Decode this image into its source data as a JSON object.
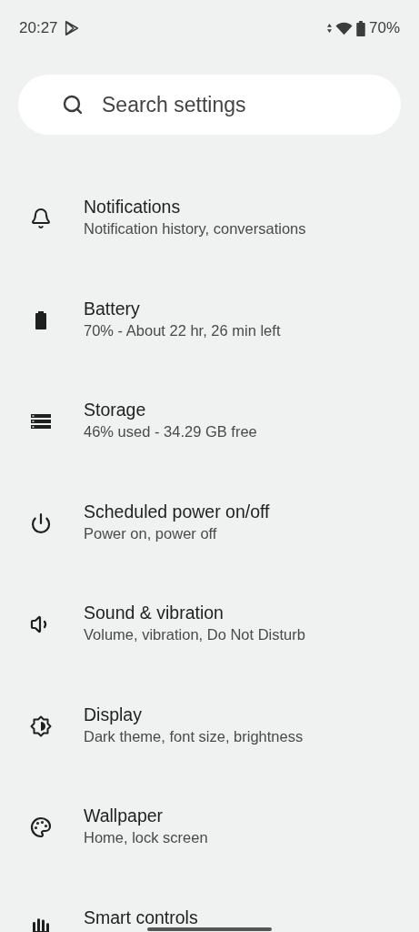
{
  "status_bar": {
    "time": "20:27",
    "battery": "70%"
  },
  "search": {
    "placeholder": "Search settings"
  },
  "settings": [
    {
      "kind": "notifications",
      "title": "Notifications",
      "subtitle": "Notification history, conversations"
    },
    {
      "kind": "battery",
      "title": "Battery",
      "subtitle": "70% - About 22 hr, 26 min left"
    },
    {
      "kind": "storage",
      "title": "Storage",
      "subtitle": "46% used - 34.29 GB free"
    },
    {
      "kind": "power",
      "title": "Scheduled power on/off",
      "subtitle": "Power on, power off"
    },
    {
      "kind": "sound",
      "title": "Sound & vibration",
      "subtitle": "Volume, vibration, Do Not Disturb"
    },
    {
      "kind": "display",
      "title": "Display",
      "subtitle": "Dark theme, font size, brightness"
    },
    {
      "kind": "wallpaper",
      "title": "Wallpaper",
      "subtitle": "Home, lock screen"
    },
    {
      "kind": "gestures",
      "title": "Smart controls"
    }
  ]
}
